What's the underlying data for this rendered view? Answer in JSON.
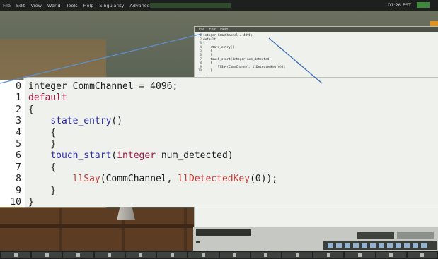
{
  "menubar": {
    "items": [
      "File",
      "Edit",
      "View",
      "World",
      "Tools",
      "Help",
      "Singularity",
      "Advanced"
    ],
    "clock": "01:26 PST"
  },
  "small_window": {
    "menu": [
      "File",
      "Edit",
      "Help"
    ],
    "gutter": [
      "1",
      "2",
      "3",
      "4",
      "5",
      "6",
      "7",
      "8",
      "9",
      "10"
    ],
    "code": [
      "integer CommChannel = 4096;",
      "default",
      "{",
      "    state_entry()",
      "    {",
      "    }",
      "    touch_start(integer num_detected)",
      "    {",
      "        llSay(CommChannel, llDetectedKey(0));",
      "    }",
      "}"
    ]
  },
  "zoom_panel": {
    "line_numbers": [
      "0",
      "1",
      "2",
      "3",
      "4",
      "5",
      "6",
      "7",
      "8",
      "9",
      "10"
    ],
    "lines": [
      [
        {
          "t": "integer CommChannel = 4096;",
          "c": "tk"
        }
      ],
      [
        {
          "t": "default",
          "c": "kw"
        }
      ],
      [
        {
          "t": "{",
          "c": "tk"
        }
      ],
      [
        {
          "t": "    ",
          "c": "tk"
        },
        {
          "t": "state_entry",
          "c": "fn"
        },
        {
          "t": "()",
          "c": "tk"
        }
      ],
      [
        {
          "t": "    {",
          "c": "tk"
        }
      ],
      [
        {
          "t": "    }",
          "c": "tk"
        }
      ],
      [
        {
          "t": "    ",
          "c": "tk"
        },
        {
          "t": "touch_start",
          "c": "fn"
        },
        {
          "t": "(",
          "c": "tk"
        },
        {
          "t": "integer",
          "c": "kw"
        },
        {
          "t": " num_detected)",
          "c": "tk"
        }
      ],
      [
        {
          "t": "    {",
          "c": "tk"
        }
      ],
      [
        {
          "t": "        ",
          "c": "tk"
        },
        {
          "t": "llSay",
          "c": "ll"
        },
        {
          "t": "(CommChannel, ",
          "c": "tk"
        },
        {
          "t": "llDetectedKey",
          "c": "ll"
        },
        {
          "t": "(0));",
          "c": "tk"
        }
      ],
      [
        {
          "t": "    }",
          "c": "tk"
        }
      ],
      [
        {
          "t": "}",
          "c": "tk"
        }
      ]
    ]
  },
  "colors": {
    "keyword": "#a01648",
    "event": "#2a2aa8",
    "builtin": "#c23c3c",
    "annotation_line": "#3b6fb6"
  }
}
